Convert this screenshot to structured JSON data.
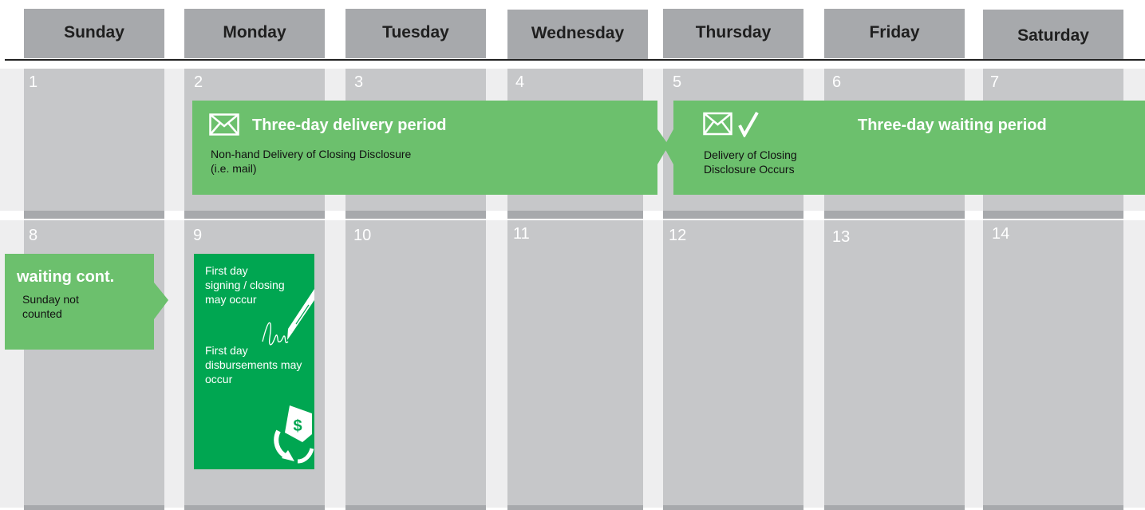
{
  "days": [
    "Sunday",
    "Monday",
    "Tuesday",
    "Wednesday",
    "Thursday",
    "Friday",
    "Saturday"
  ],
  "week1": [
    "1",
    "2",
    "3",
    "4",
    "5",
    "6",
    "7"
  ],
  "week2": [
    "8",
    "9",
    "10",
    "11",
    "12",
    "13",
    "14"
  ],
  "delivery": {
    "title": "Three-day delivery period",
    "line1": "Non-hand Delivery of Closing Disclosure",
    "line2": "(i.e. mail)",
    "icon": "envelope-icon"
  },
  "waiting": {
    "title": "Three-day waiting period",
    "line1": "Delivery of Closing",
    "line2": "Disclosure Occurs",
    "icon": "envelope-check-icon"
  },
  "waiting_cont": {
    "title": "waiting cont.",
    "line1": "Sunday not",
    "line2": "counted"
  },
  "first_day": {
    "signing_line1": "First day",
    "signing_line2": "signing / closing",
    "signing_line3": "may occur",
    "disb_line1": "First day",
    "disb_line2": "disbursements may",
    "disb_line3": "occur",
    "icons": [
      "pen-signature-icon",
      "money-cycle-icon"
    ]
  },
  "colors": {
    "header_gray": "#a7a9ac",
    "column_gray": "#c6c7c9",
    "light_green": "#6cc06d",
    "dark_green": "#00a651"
  }
}
